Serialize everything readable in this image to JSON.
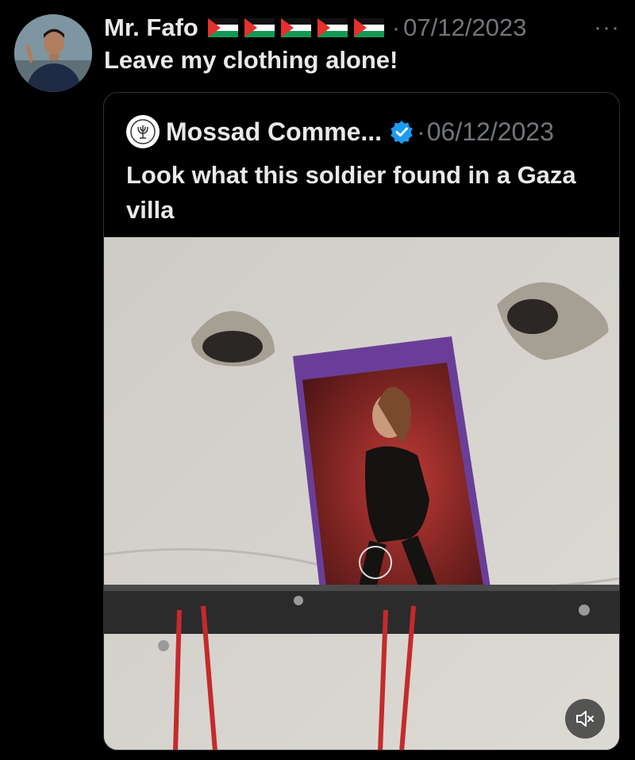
{
  "tweet": {
    "display_name": "Mr. Fafo",
    "flag_count": 5,
    "separator": "·",
    "date": "07/12/2023",
    "more_label": "···",
    "text": "Leave my clothing alone!"
  },
  "quoted": {
    "display_name": "Mossad Comme...",
    "verified": true,
    "separator": "·",
    "date": "06/12/2023",
    "text": "Look what this soldier found in a Gaza villa"
  },
  "media": {
    "type": "video",
    "mute_icon": "speaker-muted-icon"
  },
  "colors": {
    "background": "#000000",
    "text_primary": "#e7e9ea",
    "text_secondary": "#71767b",
    "verified_blue": "#1d9bf0",
    "border": "#2f3336"
  }
}
